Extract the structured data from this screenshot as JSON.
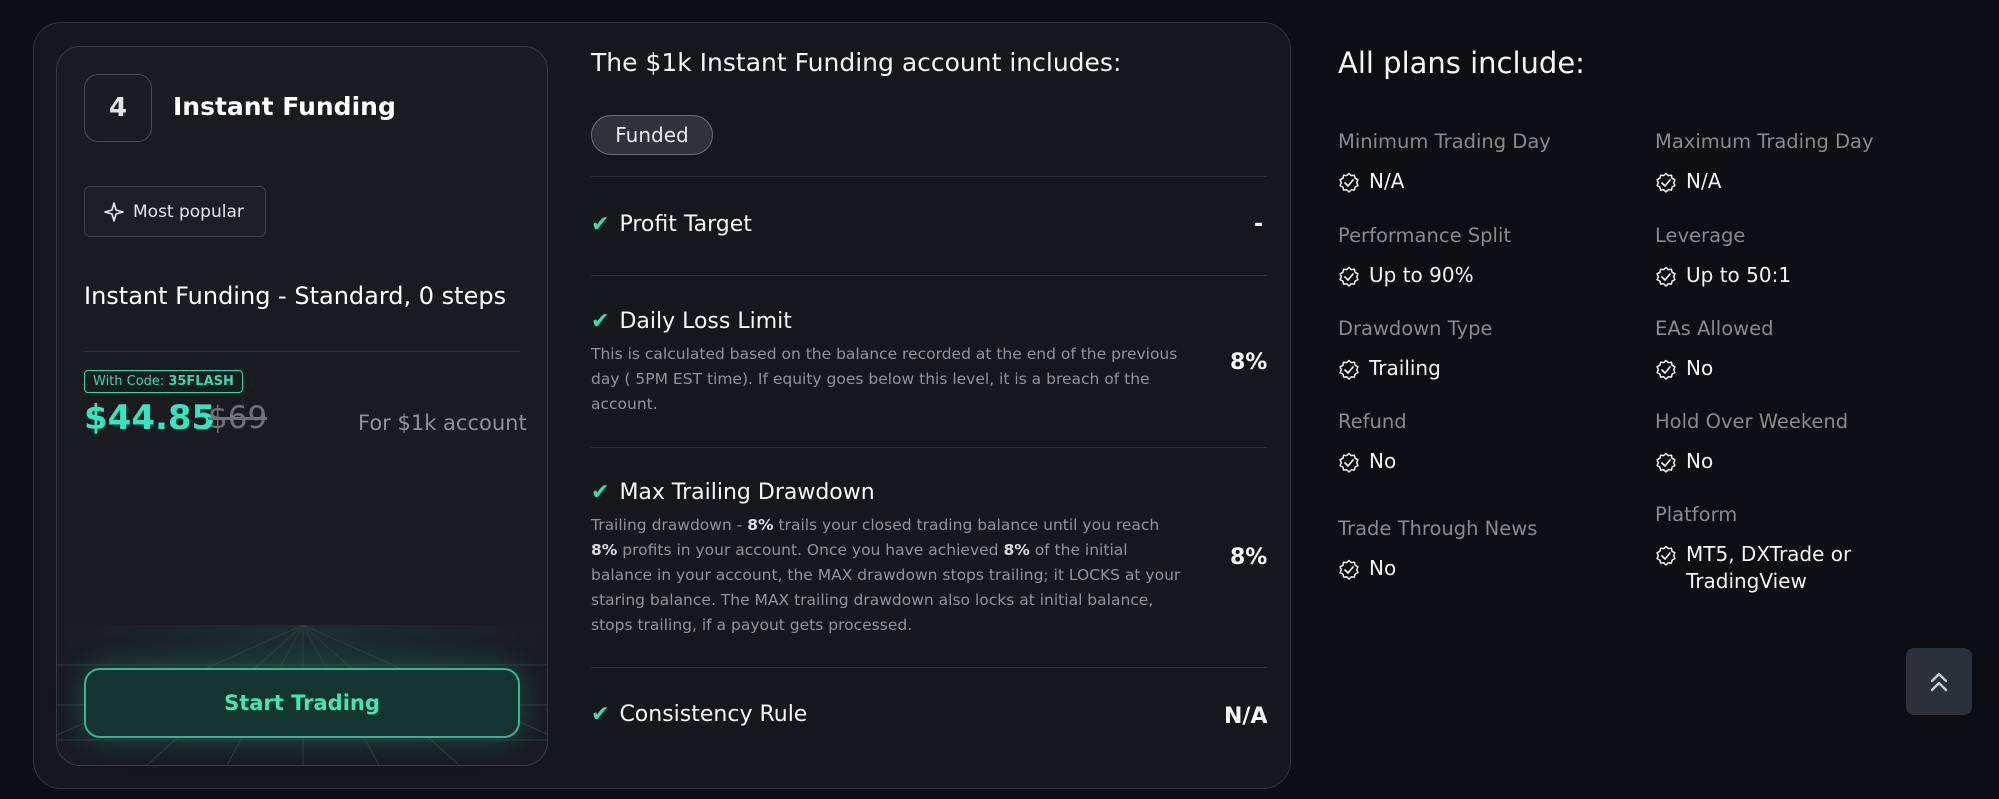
{
  "plan": {
    "number": "4",
    "title": "Instant Funding",
    "badge": "Most popular",
    "description": "Instant Funding - Standard, 0 steps",
    "code_label": "With Code:",
    "code": "35FLASH",
    "price": "$44.85",
    "old_price": "$69",
    "per_account": "For $1k account",
    "cta": "Start Trading"
  },
  "includes": {
    "title": "The $1k Instant Funding account includes:",
    "tag": "Funded",
    "rows": [
      {
        "title": "Profit Target",
        "value": "-"
      },
      {
        "title": "Daily Loss Limit",
        "value": "8%",
        "desc": "This is calculated based on the balance recorded at the end of the previous day ( 5PM EST time). If equity goes below this level, it is a breach of the account."
      },
      {
        "title": "Max Trailing Drawdown",
        "value": "8%",
        "desc_parts": {
          "p1": "Trailing drawdown - ",
          "b1": "8%",
          "p2": " trails your closed trading balance until you reach ",
          "b2": "8%",
          "p3": " profits in your account. Once you have achieved ",
          "b3": "8%",
          "p4": " of the initial balance in your account, the MAX drawdown stops trailing; it LOCKS at your staring balance. The MAX trailing drawdown also locks at initial balance, stops trailing, if a payout gets processed."
        }
      },
      {
        "title": "Consistency Rule",
        "value": "N/A"
      }
    ]
  },
  "all_plans": {
    "title": "All plans include:",
    "features": [
      {
        "label": "Minimum Trading Day",
        "value": "N/A"
      },
      {
        "label": "Maximum Trading Day",
        "value": "N/A"
      },
      {
        "label": "Performance Split",
        "value": "Up to 90%"
      },
      {
        "label": "Leverage",
        "value": "Up to 50:1"
      },
      {
        "label": "Drawdown Type",
        "value": "Trailing"
      },
      {
        "label": "EAs Allowed",
        "value": "No"
      },
      {
        "label": "Refund",
        "value": "No"
      },
      {
        "label": "Hold Over Weekend",
        "value": "No"
      },
      {
        "label": "Trade Through News",
        "value": "No"
      },
      {
        "label": "Platform",
        "value": "MT5, DXTrade or",
        "value2": "TradingView"
      }
    ]
  },
  "icons": {
    "check": "check-icon",
    "sparkle": "sparkle-icon",
    "check_circle": "check-circle-icon",
    "scroll_top": "double-chevron-up-icon"
  },
  "colors": {
    "accent": "#2fe8bf",
    "background": "#0c0e13",
    "card": "#15171c"
  }
}
